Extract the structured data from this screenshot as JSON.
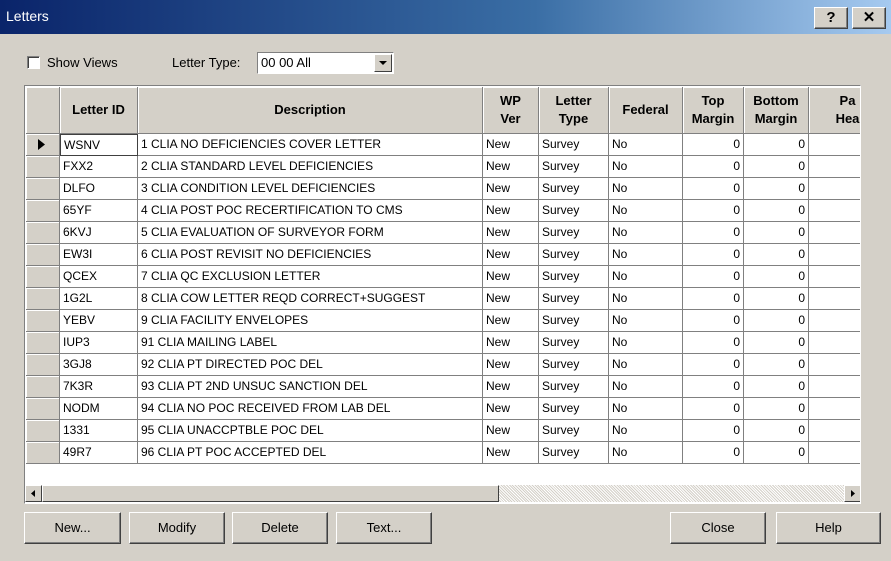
{
  "window": {
    "title": "Letters",
    "help_glyph": "?",
    "close_glyph": "✕"
  },
  "filters": {
    "show_views_label": "Show Views",
    "show_views_checked": false,
    "letter_type_label": "Letter Type:",
    "letter_type_value": "00  00  All"
  },
  "grid": {
    "headers": {
      "letter_id": "Letter ID",
      "description": "Description",
      "wp_ver_1": "WP",
      "wp_ver_2": "Ver",
      "letter_type_1": "Letter",
      "letter_type_2": "Type",
      "federal": "Federal",
      "top_margin_1": "Top",
      "top_margin_2": "Margin",
      "bottom_margin_1": "Bottom",
      "bottom_margin_2": "Margin",
      "page_header_1": "Pa",
      "page_header_2": "Hea"
    },
    "rows": [
      {
        "id": "WSNV",
        "desc": "1 CLIA NO DEFICIENCIES COVER LETTER",
        "wp": "New",
        "type": "Survey",
        "federal": "No",
        "top": "0",
        "bottom": "0"
      },
      {
        "id": "FXX2",
        "desc": "2 CLIA STANDARD LEVEL DEFICIENCIES",
        "wp": "New",
        "type": "Survey",
        "federal": "No",
        "top": "0",
        "bottom": "0"
      },
      {
        "id": "DLFO",
        "desc": "3 CLIA CONDITION LEVEL DEFICIENCIES",
        "wp": "New",
        "type": "Survey",
        "federal": "No",
        "top": "0",
        "bottom": "0"
      },
      {
        "id": "65YF",
        "desc": "4 CLIA POST POC RECERTIFICATION TO CMS",
        "wp": "New",
        "type": "Survey",
        "federal": "No",
        "top": "0",
        "bottom": "0"
      },
      {
        "id": "6KVJ",
        "desc": "5 CLIA EVALUATION OF SURVEYOR FORM",
        "wp": "New",
        "type": "Survey",
        "federal": "No",
        "top": "0",
        "bottom": "0"
      },
      {
        "id": "EW3I",
        "desc": "6 CLIA POST REVISIT NO DEFICIENCIES",
        "wp": "New",
        "type": "Survey",
        "federal": "No",
        "top": "0",
        "bottom": "0"
      },
      {
        "id": "QCEX",
        "desc": "7 CLIA QC EXCLUSION LETTER",
        "wp": "New",
        "type": "Survey",
        "federal": "No",
        "top": "0",
        "bottom": "0"
      },
      {
        "id": "1G2L",
        "desc": "8 CLIA COW LETTER REQD CORRECT+SUGGEST",
        "wp": "New",
        "type": "Survey",
        "federal": "No",
        "top": "0",
        "bottom": "0"
      },
      {
        "id": "YEBV",
        "desc": "9 CLIA FACILITY ENVELOPES",
        "wp": "New",
        "type": "Survey",
        "federal": "No",
        "top": "0",
        "bottom": "0"
      },
      {
        "id": "IUP3",
        "desc": "91 CLIA MAILING LABEL",
        "wp": "New",
        "type": "Survey",
        "federal": "No",
        "top": "0",
        "bottom": "0"
      },
      {
        "id": "3GJ8",
        "desc": "92 CLIA PT DIRECTED POC DEL",
        "wp": "New",
        "type": "Survey",
        "federal": "No",
        "top": "0",
        "bottom": "0"
      },
      {
        "id": "7K3R",
        "desc": "93 CLIA PT 2ND UNSUC SANCTION DEL",
        "wp": "New",
        "type": "Survey",
        "federal": "No",
        "top": "0",
        "bottom": "0"
      },
      {
        "id": "NODM",
        "desc": "94 CLIA NO POC RECEIVED FROM LAB DEL",
        "wp": "New",
        "type": "Survey",
        "federal": "No",
        "top": "0",
        "bottom": "0"
      },
      {
        "id": "1331",
        "desc": "95 CLIA  UNACCPTBLE POC DEL",
        "wp": "New",
        "type": "Survey",
        "federal": "No",
        "top": "0",
        "bottom": "0"
      },
      {
        "id": "49R7",
        "desc": "96 CLIA  PT POC ACCEPTED DEL",
        "wp": "New",
        "type": "Survey",
        "federal": "No",
        "top": "0",
        "bottom": "0"
      }
    ],
    "selected_row": 0
  },
  "buttons": {
    "new": "New...",
    "modify": "Modify",
    "delete": "Delete",
    "text": "Text...",
    "close": "Close",
    "help": "Help"
  }
}
